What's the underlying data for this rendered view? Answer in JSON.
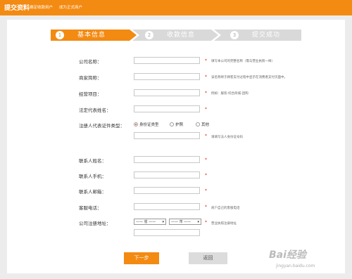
{
  "header": {
    "title": "提交资料",
    "sub1": "确定收款用户",
    "sub2": "成为正式商户"
  },
  "steps": [
    {
      "num": "1",
      "label": "基本信息"
    },
    {
      "num": "2",
      "label": "收款信息"
    },
    {
      "num": "3",
      "label": "提交成功"
    }
  ],
  "form": {
    "company_label": "公司名称：",
    "company_hint": "填写本公司的完整名称（需与营业执照一样）",
    "shop_label": "商家简称：",
    "shop_hint": "该名称将于顾客支付过程中显示在消费者支付页面中。",
    "business_label": "经营项目：",
    "business_hint": "例如：服装-综合商城-团购",
    "legal_label": "法定代表姓名：",
    "id_type_label": "注册人代表证件类型：",
    "id_options": [
      "身份证类型",
      "护照",
      "其他"
    ],
    "id_hint": "请填写法人身份证号码",
    "contact_name_label": "联系人姓名：",
    "contact_phone_label": "联系人手机：",
    "contact_email_label": "联系人邮箱：",
    "service_phone_label": "客服电话：",
    "service_phone_hint": "商户自己的客服电话",
    "address_label": "公司注册地址：",
    "province": "—— 省 ——",
    "city": "—— 市 ——",
    "address_hint": "营业执照注册地址",
    "star": "*"
  },
  "buttons": {
    "next": "下一步",
    "back": "返回"
  },
  "watermark": {
    "main": "Bai经验",
    "url": "jingyan.baidu.com"
  },
  "colors": {
    "accent": "#f38a12",
    "step_inactive": "#d9d9d9",
    "required": "#e02020"
  }
}
